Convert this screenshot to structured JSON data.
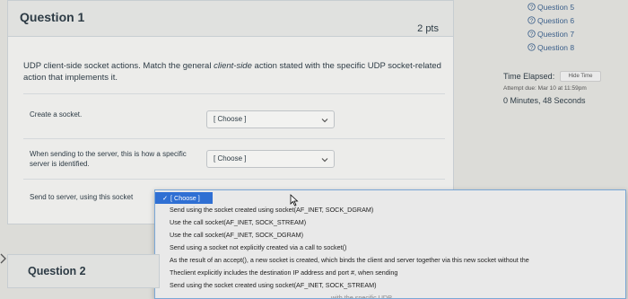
{
  "question1": {
    "title": "Question 1",
    "points": "2 pts",
    "prompt_part1": "UDP client-side socket actions. Match the general ",
    "prompt_em": "client-side",
    "prompt_part2": " action stated with the specific UDP socket-related action that implements it.",
    "rows": [
      {
        "label": "Create a socket.",
        "selected": "[ Choose ]"
      },
      {
        "label": "When sending to the server, this is how a specific server is identified.",
        "selected": "[ Choose ]"
      },
      {
        "label": "Send to server, using this socket"
      }
    ]
  },
  "dropdown": {
    "selected": "[ Choose ]",
    "options": [
      "Send using the socket created using socket(AF_INET, SOCK_DGRAM)",
      "Use the call socket(AF_INET, SOCK_STREAM)",
      "Use the call socket(AF_INET, SOCK_DGRAM)",
      "Send using a socket not explicitly created via a call to socket()",
      "As the result of an accept(), a new socket is created, which binds the client and server together via this new socket without the",
      "Theclient explicitly includes the destination IP address and port #, when sending",
      "Send using the socket created using socket(AF_INET, SOCK_STREAM)",
      "...with the specific UDP"
    ]
  },
  "question2": {
    "title": "Question 2"
  },
  "sidebar": {
    "questions": [
      "Question 5",
      "Question 6",
      "Question 7",
      "Question 8"
    ],
    "time_elapsed_label": "Time Elapsed:",
    "hide_time_label": "Hide Time",
    "attempt_due": "Attempt due: Mar 10 at 11:59pm",
    "time_value": "0 Minutes, 48 Seconds"
  }
}
